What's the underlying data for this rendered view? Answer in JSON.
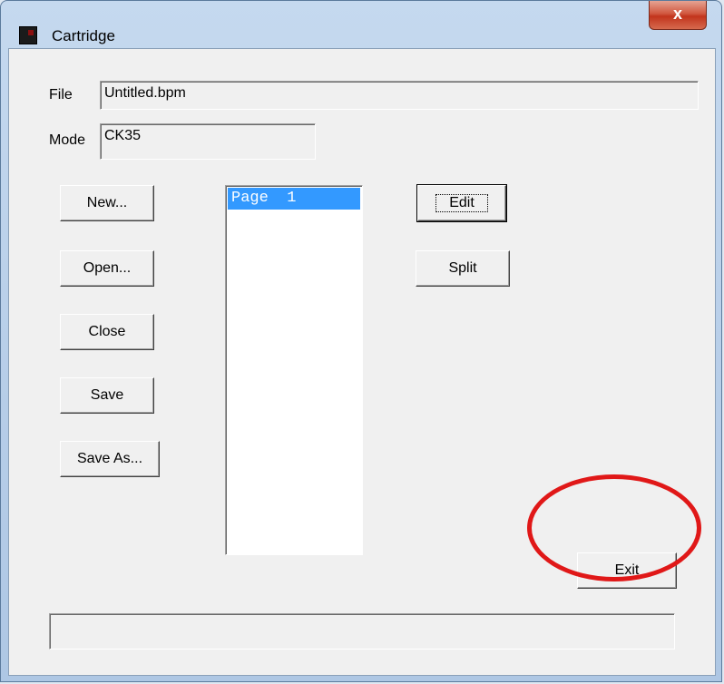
{
  "window": {
    "title": "Cartridge",
    "close_glyph": "x"
  },
  "fields": {
    "file_label": "File",
    "file_value": "Untitled.bpm",
    "mode_label": "Mode",
    "mode_value": "CK35"
  },
  "buttons": {
    "new": "New...",
    "open": "Open...",
    "close": "Close",
    "save": "Save",
    "save_as": "Save As...",
    "edit": "Edit",
    "split": "Split",
    "exit": "Exit"
  },
  "pages_list": {
    "items": [
      "Page  1"
    ],
    "selected_index": 0
  },
  "status_text": "",
  "colors": {
    "selection": "#3399ff",
    "annotation": "#e01818",
    "close_button": "#c2341c"
  },
  "icons": {
    "app": "cartridge-app-icon",
    "close": "close-icon"
  }
}
